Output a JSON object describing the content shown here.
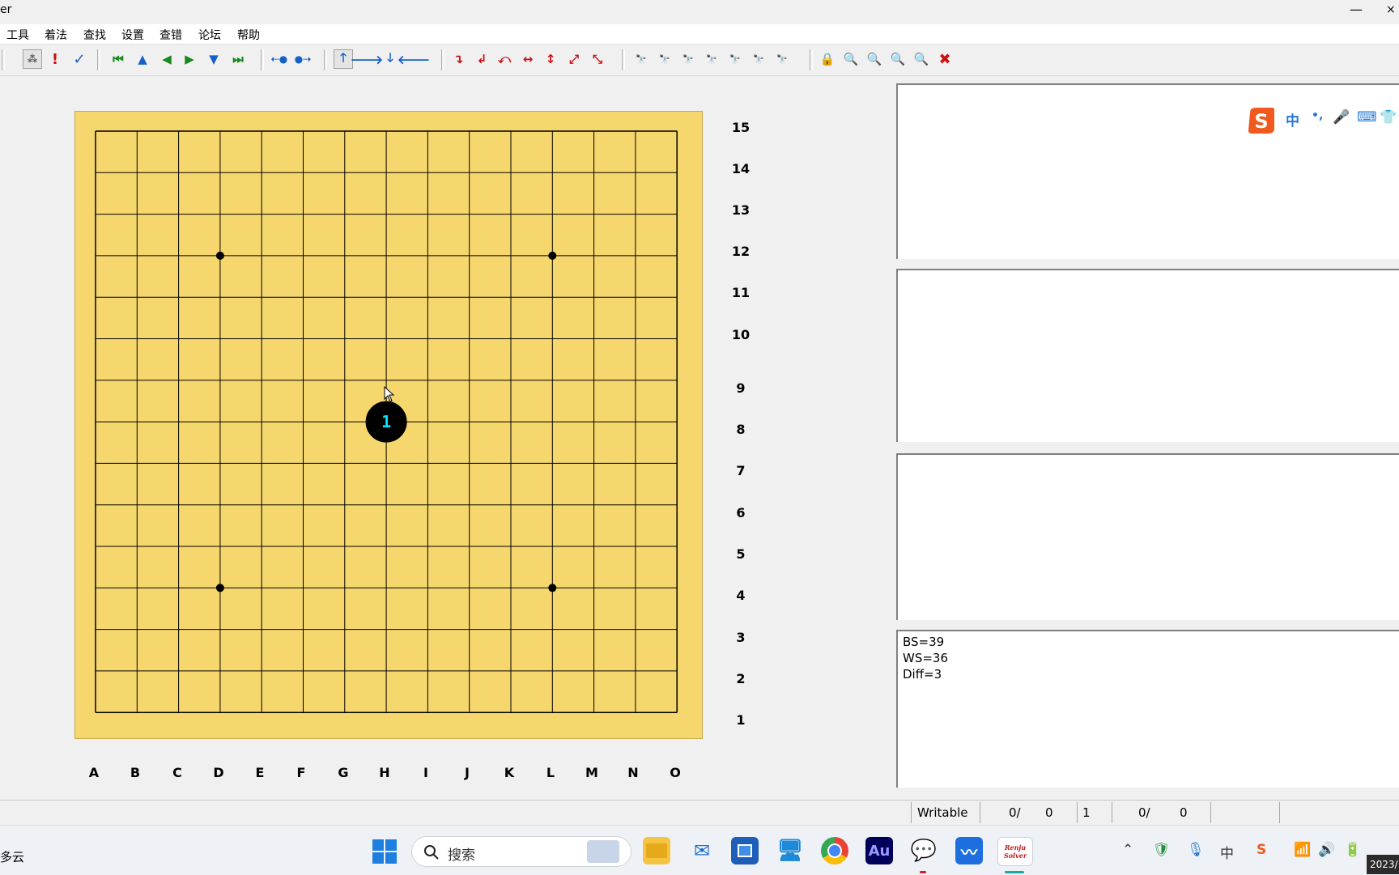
{
  "window": {
    "title": "er",
    "minimize": "—",
    "close": "×"
  },
  "menu": [
    "工具",
    "着法",
    "查找",
    "设置",
    "查错",
    "论坛",
    "帮助"
  ],
  "board": {
    "size": 15,
    "row_labels": [
      "15",
      "14",
      "13",
      "12",
      "11",
      "10",
      "9",
      "8",
      "7",
      "6",
      "5",
      "4",
      "3",
      "2",
      "1"
    ],
    "col_labels": [
      "A",
      "B",
      "C",
      "D",
      "E",
      "F",
      "G",
      "H",
      "I",
      "J",
      "K",
      "L",
      "M",
      "N",
      "O"
    ],
    "stones": [
      {
        "col": "H",
        "row": 8,
        "color": "black",
        "number": "1"
      }
    ],
    "star_points": [
      "D12",
      "L12",
      "D4",
      "L4"
    ]
  },
  "info": {
    "line1": "BS=39",
    "line2": "WS=36",
    "line3": "Diff=3"
  },
  "ime": {
    "chinese": "中",
    "punct": "•,",
    "mic": "🎤",
    "keyboard": "⌨",
    "skin": "👕"
  },
  "status": {
    "mode": "Writable",
    "field1a": "0/",
    "field1b": "0",
    "field2": "1",
    "field3a": "0/",
    "field3b": "0"
  },
  "taskbar": {
    "weather": "多云",
    "search_placeholder": "搜索",
    "renju_app_line1": "Renju",
    "renju_app_line2": "Solver",
    "audition_label": "Au",
    "ime_tray": "中",
    "clock": "2023/"
  },
  "colors": {
    "board": "#f5d76e",
    "toolbar_blue": "#1560c8",
    "toolbar_red": "#cc1010",
    "stone_number": "#00e5ff"
  }
}
